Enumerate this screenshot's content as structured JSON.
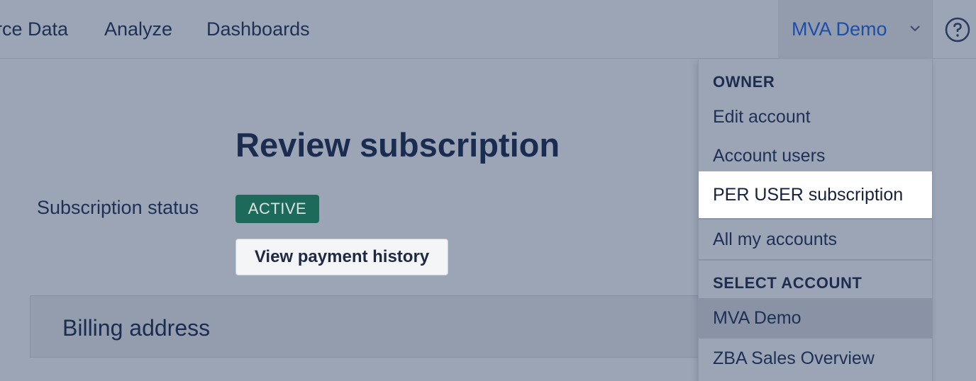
{
  "nav": {
    "items": [
      {
        "label": "rce Data"
      },
      {
        "label": "Analyze"
      },
      {
        "label": "Dashboards"
      }
    ],
    "account_label": "MVA Demo",
    "chevron_icon": "chevron-down-icon",
    "help_icon": "help-icon"
  },
  "main": {
    "title": "Review subscription",
    "status_label": "Subscription status",
    "status_badge": "ACTIVE",
    "history_button": "View payment history",
    "billing_title": "Billing address"
  },
  "dropdown": {
    "owner_header": "OWNER",
    "owner_items": [
      {
        "label": "Edit account"
      },
      {
        "label": "Account users"
      },
      {
        "label": "PER USER subscription"
      },
      {
        "label": "All my accounts"
      }
    ],
    "select_header": "SELECT ACCOUNT",
    "accounts": [
      {
        "label": "MVA Demo"
      },
      {
        "label": "ZBA Sales Overview"
      }
    ]
  },
  "colors": {
    "accent": "#1d4ea8",
    "badge_bg": "#1e6a5a",
    "overlay_bg": "#9ca5b5"
  }
}
